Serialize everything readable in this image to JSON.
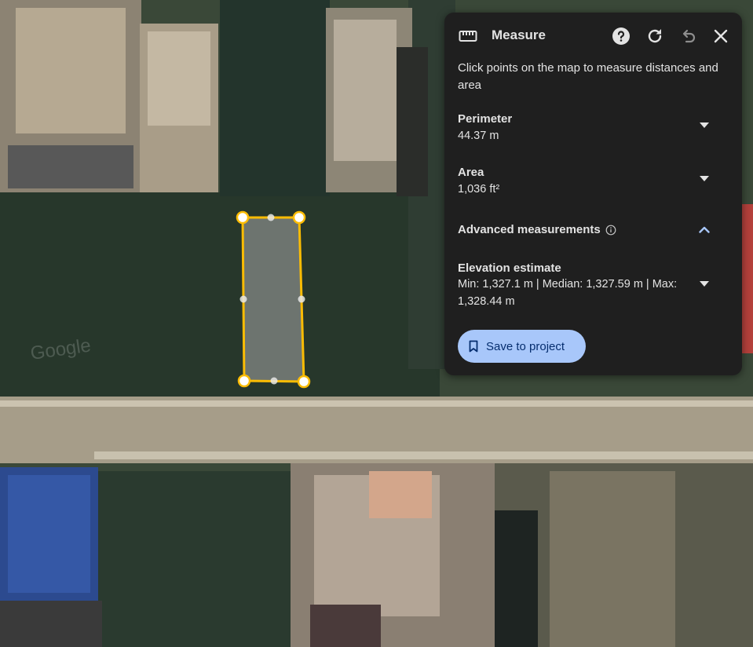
{
  "panel": {
    "title": "Measure",
    "description": "Click points on the map to measure distances and area",
    "perimeter": {
      "label": "Perimeter",
      "value": "44.37 m"
    },
    "area": {
      "label": "Area",
      "value": "1,036 ft²"
    },
    "advanced": {
      "label": "Advanced measurements"
    },
    "elevation": {
      "label": "Elevation estimate",
      "value": "Min: 1,327.1 m | Median: 1,327.59 m | Max: 1,328.44 m"
    },
    "save_button": "Save to project",
    "icons": [
      "ruler-icon",
      "help-icon",
      "reset-icon",
      "undo-icon",
      "close-icon"
    ]
  },
  "map": {
    "watermark": "Google",
    "colors": {
      "polygon_stroke": "#fbbc04",
      "accent": "#a8c7fa",
      "panel_bg": "#1f1f1f"
    }
  }
}
